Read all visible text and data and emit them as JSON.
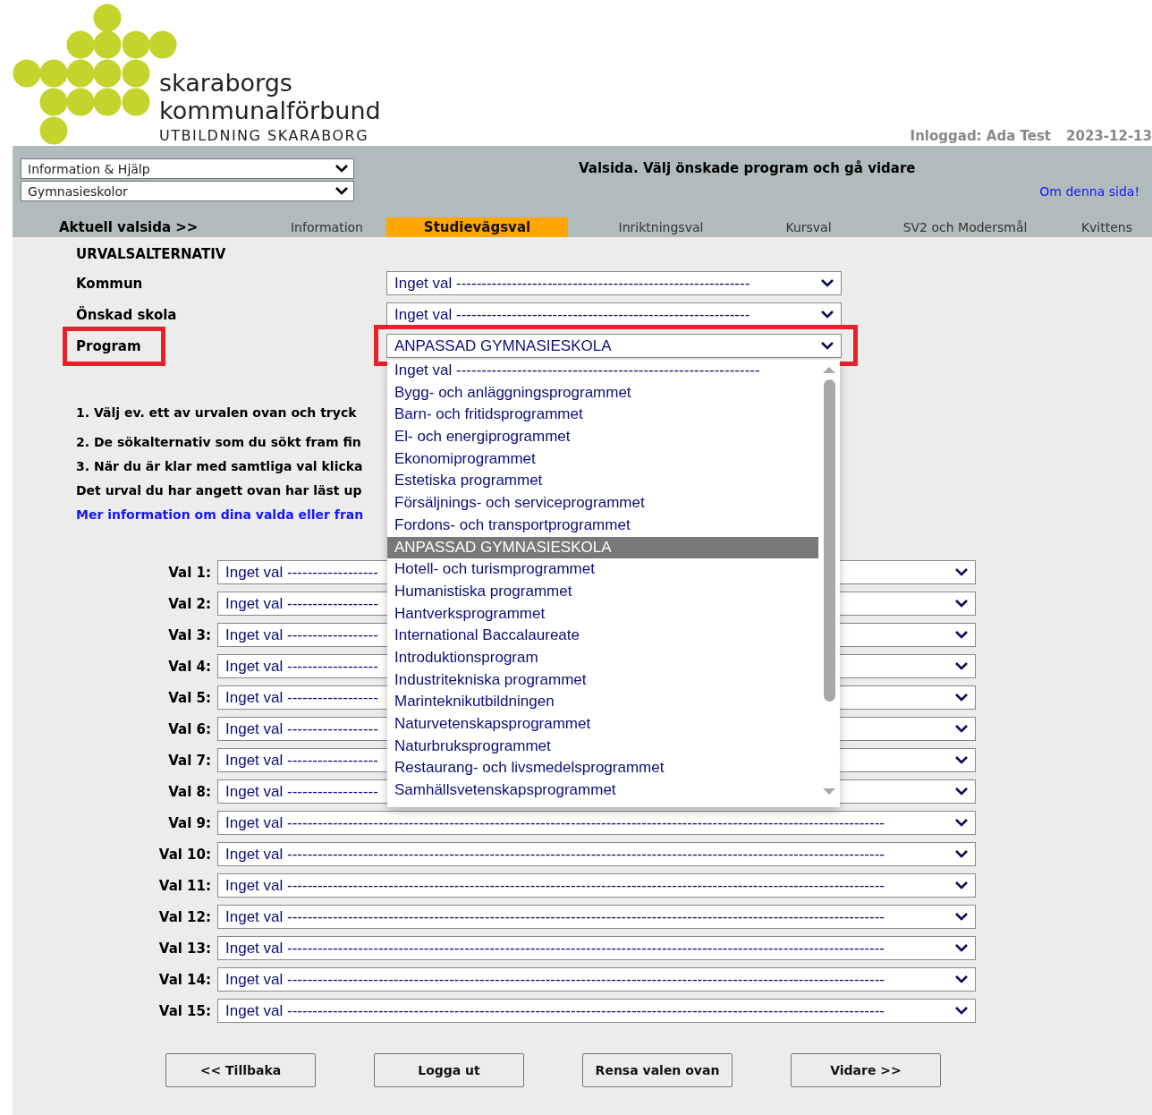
{
  "logo": {
    "line_1": "skaraborgs",
    "line_2": "kommunalförbund",
    "tagline": "UTBILDNING SKARABORG"
  },
  "user_info": {
    "logged_in": "Inloggad: Ada Test",
    "date": "2023-12-13"
  },
  "nav_selects": [
    {
      "value": "Information & Hjälp"
    },
    {
      "value": "Gymnasieskolor"
    }
  ],
  "page_title": "Valsida. Välj önskade program och gå vidare",
  "help_link": "Om denna sida!",
  "tabs_label": "Aktuell valsida >>",
  "tabs": [
    {
      "label": "Information",
      "selected": false
    },
    {
      "label": "Studievägsval",
      "selected": true
    },
    {
      "label": "Inriktningsval",
      "selected": false
    },
    {
      "label": "Kursval",
      "selected": false
    },
    {
      "label": "SV2 och Modersmål",
      "selected": false
    },
    {
      "label": "Kvittens",
      "selected": false
    }
  ],
  "section_title": "URVALSALTERNATIV",
  "filters": [
    {
      "label": "Kommun",
      "value": "Inget val ----------------------------------------------------------",
      "highlighted": false
    },
    {
      "label": "Önskad skola",
      "value": "Inget val ----------------------------------------------------------",
      "highlighted": false
    },
    {
      "label": "Program",
      "value": "ANPASSAD GYMNASIESKOLA",
      "highlighted": true
    }
  ],
  "program_options": [
    {
      "label": "Inget val ------------------------------------------------------------",
      "selected": false
    },
    {
      "label": "Bygg- och anläggningsprogrammet",
      "selected": false
    },
    {
      "label": "Barn- och fritidsprogrammet",
      "selected": false
    },
    {
      "label": "El- och energiprogrammet",
      "selected": false
    },
    {
      "label": "Ekonomiprogrammet",
      "selected": false
    },
    {
      "label": "Estetiska programmet",
      "selected": false
    },
    {
      "label": "Försäljnings- och serviceprogrammet",
      "selected": false
    },
    {
      "label": "Fordons- och transportprogrammet",
      "selected": false
    },
    {
      "label": "ANPASSAD GYMNASIESKOLA",
      "selected": true
    },
    {
      "label": "Hotell- och turismprogrammet",
      "selected": false
    },
    {
      "label": "Humanistiska programmet",
      "selected": false
    },
    {
      "label": "Hantverksprogrammet",
      "selected": false
    },
    {
      "label": "International Baccalaureate",
      "selected": false
    },
    {
      "label": "Introduktionsprogram",
      "selected": false
    },
    {
      "label": "Industritekniska programmet",
      "selected": false
    },
    {
      "label": "Marinteknikutbildningen",
      "selected": false
    },
    {
      "label": "Naturvetenskapsprogrammet",
      "selected": false
    },
    {
      "label": "Naturbruksprogrammet",
      "selected": false
    },
    {
      "label": "Restaurang- och livsmedelsprogrammet",
      "selected": false
    },
    {
      "label": "Samhällsvetenskapsprogrammet",
      "selected": false
    }
  ],
  "instructions": [
    "1. Välj ev. ett av urvalen ovan och tryck",
    "2. De sökalternativ som du sökt fram fin",
    "3. När du är klar med samtliga val klicka",
    "Det urval du har angett ovan har läst up"
  ],
  "more_info_link": "Mer information om dina valda eller fran",
  "choices": [
    {
      "label": "Val 1:",
      "value": "Inget val ------------------"
    },
    {
      "label": "Val 2:",
      "value": "Inget val ------------------"
    },
    {
      "label": "Val 3:",
      "value": "Inget val ------------------"
    },
    {
      "label": "Val 4:",
      "value": "Inget val ------------------"
    },
    {
      "label": "Val 5:",
      "value": "Inget val ------------------"
    },
    {
      "label": "Val 6:",
      "value": "Inget val ------------------"
    },
    {
      "label": "Val 7:",
      "value": "Inget val ------------------"
    },
    {
      "label": "Val 8:",
      "value": "Inget val ------------------"
    },
    {
      "label": "Val 9:",
      "value": "Inget val ----------------------------------------------------------------------------------------------------------------------"
    },
    {
      "label": "Val 10:",
      "value": "Inget val ----------------------------------------------------------------------------------------------------------------------"
    },
    {
      "label": "Val 11:",
      "value": "Inget val ----------------------------------------------------------------------------------------------------------------------"
    },
    {
      "label": "Val 12:",
      "value": "Inget val ----------------------------------------------------------------------------------------------------------------------"
    },
    {
      "label": "Val 13:",
      "value": "Inget val ----------------------------------------------------------------------------------------------------------------------"
    },
    {
      "label": "Val 14:",
      "value": "Inget val ----------------------------------------------------------------------------------------------------------------------"
    },
    {
      "label": "Val 15:",
      "value": "Inget val ----------------------------------------------------------------------------------------------------------------------"
    }
  ],
  "buttons": [
    "<< Tillbaka",
    "Logga ut",
    "Rensa valen ovan",
    "Vidare  >>"
  ]
}
